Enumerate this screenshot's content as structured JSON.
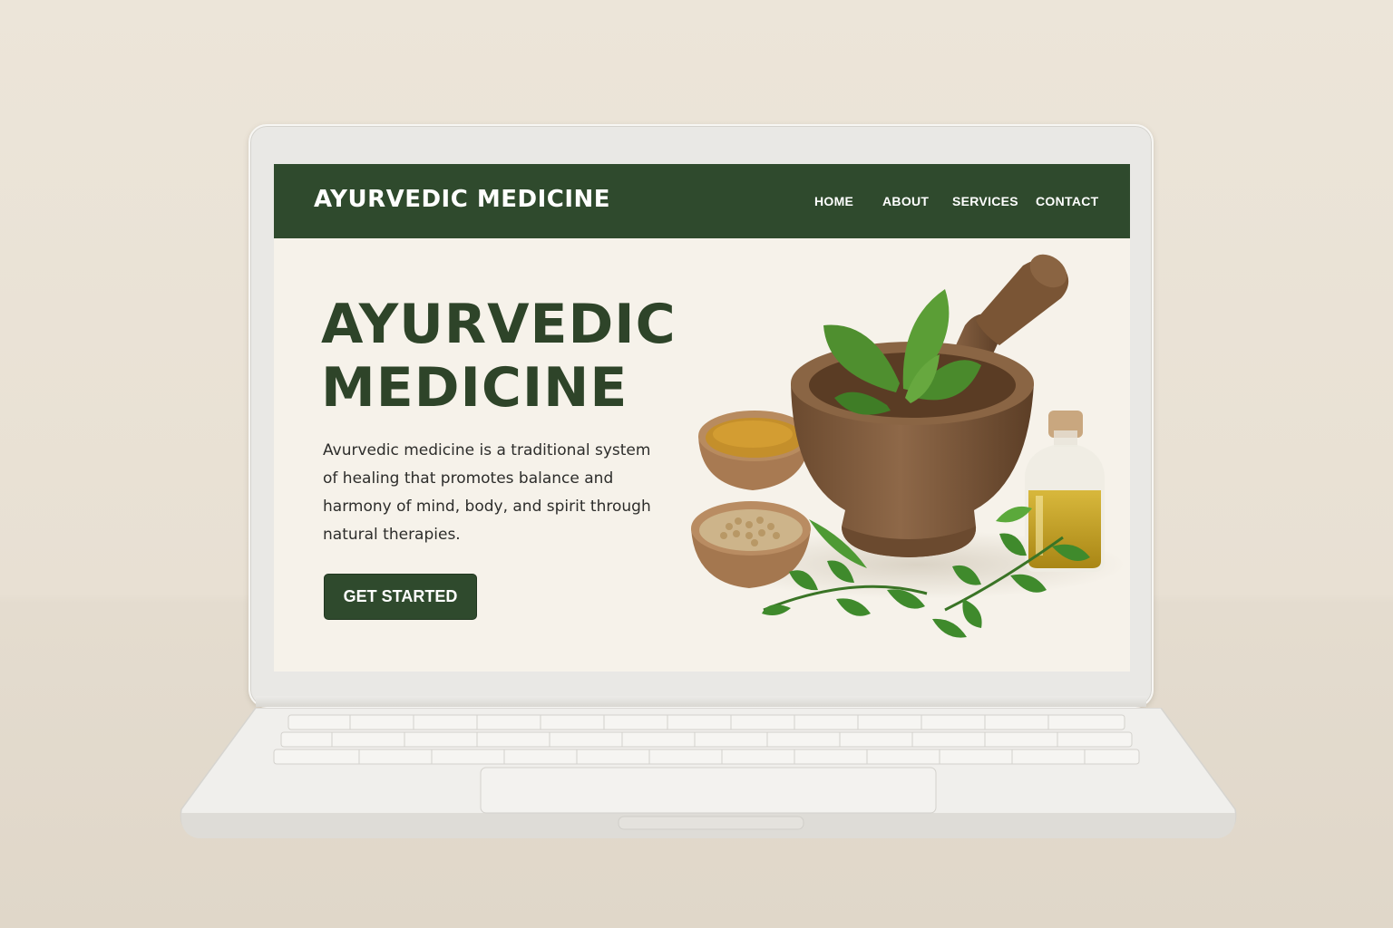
{
  "site": {
    "brand": "AYURVEDIC MEDICINE",
    "nav": [
      {
        "label": "HOME"
      },
      {
        "label": "ABOUT"
      },
      {
        "label": "SERVICES"
      },
      {
        "label": "CONTACT"
      }
    ]
  },
  "hero": {
    "title_line1": "AYURVEDIC",
    "title_line2": "MEDICINE",
    "description": "Avurvedic medicine is a traditional system of healing that promotes balance and harmony of mind, body, and spirit through natural therapies.",
    "cta_label": "GET STARTED",
    "illustration": "mortar-pestle-herbs-spices-oil-icon"
  },
  "colors": {
    "primary_green": "#2f4a2d",
    "heading_green": "#2e4429",
    "page_background": "#f6f2ea",
    "backdrop": "#e9e2d6"
  }
}
